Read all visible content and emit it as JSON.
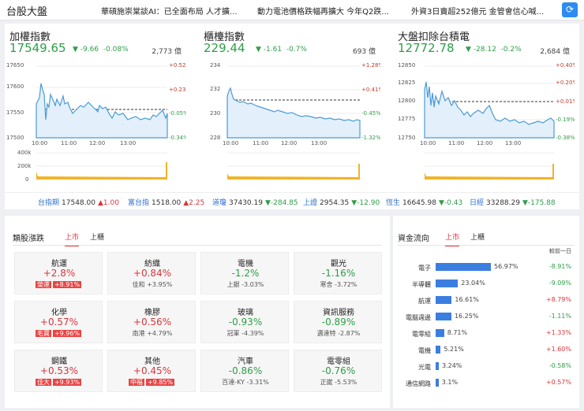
{
  "header": {
    "title": "台股大盤",
    "news": [
      "華碩施崇棠談AI：已全面布局 人才擴...",
      "動力電池價格跌幅再擴大 今年Q2跌...",
      "外資3日賣超252億元 金管會信心喊..."
    ],
    "refresh_icon": "refresh-icon"
  },
  "indices": [
    {
      "name": "加權指數",
      "value": "17549.65",
      "change": "-9.66",
      "pct": "-0.08%",
      "volume": "2,773 億",
      "y_left": [
        "17650",
        "17600",
        "17550",
        "17500"
      ],
      "y_right": [
        "+0.52%",
        "+0.23%",
        "-0.05%",
        "-0.34%"
      ],
      "x_ticks": [
        "10:00",
        "11:00",
        "12:00",
        "13:00"
      ],
      "vol_ticks": [
        "400k",
        "200k",
        "0"
      ]
    },
    {
      "name": "櫃檯指數",
      "value": "229.44",
      "change": "-1.61",
      "pct": "-0.7%",
      "volume": "693 億",
      "y_left": [
        "234",
        "232",
        "230",
        "228"
      ],
      "y_right": [
        "+1.28%",
        "+0.41%",
        "-0.45%",
        "-1.32%"
      ],
      "x_ticks": [
        "10:00",
        "11:00",
        "12:00",
        "13:00"
      ],
      "vol_ticks": [
        "400k",
        "200k",
        "0"
      ]
    },
    {
      "name": "大盤扣除台積電",
      "value": "12772.78",
      "change": "-28.12",
      "pct": "-0.2%",
      "volume": "2,684 億",
      "y_left": [
        "12850",
        "12825",
        "12800",
        "12775",
        "12750"
      ],
      "y_right": [
        "+0.40%",
        "+0.20%",
        "+0.01%",
        "-0.19%",
        "-0.38%"
      ],
      "x_ticks": [
        "10:00",
        "11:00",
        "12:00",
        "13:00"
      ],
      "vol_ticks": [
        "400k",
        "200k",
        "0"
      ]
    }
  ],
  "futures": [
    {
      "name": "台指期",
      "value": "17548.00",
      "change": "▲1.00",
      "dir": "up"
    },
    {
      "name": "富台指",
      "value": "1518.00",
      "change": "▲2.25",
      "dir": "up"
    },
    {
      "name": "道瓊",
      "value": "37430.19",
      "change": "▼-284.85",
      "dir": "dn"
    },
    {
      "name": "上證",
      "value": "2954.35",
      "change": "▼-12.90",
      "dir": "dn"
    },
    {
      "name": "恆生",
      "value": "16645.98",
      "change": "▼-0.43",
      "dir": "dn"
    },
    {
      "name": "日經",
      "value": "33288.29",
      "change": "▼-175.88",
      "dir": "dn"
    }
  ],
  "sectors": {
    "title": "類股漲跌",
    "tabs": [
      "上市",
      "上櫃"
    ],
    "cards": [
      {
        "name": "航運",
        "pct": "+2.8%",
        "dir": "up",
        "stock": "榮運",
        "stock_pct": "+8.91%",
        "badge": true
      },
      {
        "name": "紡織",
        "pct": "+0.84%",
        "dir": "up",
        "stock": "佳和",
        "stock_pct": "+3.95%",
        "badge": false
      },
      {
        "name": "電機",
        "pct": "-1.2%",
        "dir": "dn",
        "stock": "上銀",
        "stock_pct": "-3.03%",
        "badge": false
      },
      {
        "name": "觀光",
        "pct": "-1.16%",
        "dir": "dn",
        "stock": "寒舍",
        "stock_pct": "-3.72%",
        "badge": false
      },
      {
        "name": "化學",
        "pct": "+0.57%",
        "dir": "up",
        "stock": "毛寶",
        "stock_pct": "+9.96%",
        "badge": true
      },
      {
        "name": "橡膠",
        "pct": "+0.56%",
        "dir": "up",
        "stock": "南港",
        "stock_pct": "+4.79%",
        "badge": false
      },
      {
        "name": "玻璃",
        "pct": "-0.93%",
        "dir": "dn",
        "stock": "冠軍",
        "stock_pct": "-4.39%",
        "badge": false
      },
      {
        "name": "資訊服務",
        "pct": "-0.89%",
        "dir": "dn",
        "stock": "邁達特",
        "stock_pct": "-2.87%",
        "badge": false
      },
      {
        "name": "鋼鐵",
        "pct": "+0.53%",
        "dir": "up",
        "stock": "佳大",
        "stock_pct": "+9.93%",
        "badge": true
      },
      {
        "name": "其他",
        "pct": "+0.45%",
        "dir": "up",
        "stock": "中福",
        "stock_pct": "+9.85%",
        "badge": true
      },
      {
        "name": "汽車",
        "pct": "-0.86%",
        "dir": "dn",
        "stock": "百達-KY",
        "stock_pct": "-3.31%",
        "badge": false
      },
      {
        "name": "電零組",
        "pct": "-0.76%",
        "dir": "dn",
        "stock": "正崴",
        "stock_pct": "-5.53%",
        "badge": false
      }
    ]
  },
  "flow": {
    "title": "資金流向",
    "tabs": [
      "上市",
      "上櫃"
    ],
    "prev_label": "較前一日",
    "rows": [
      {
        "name": "電子",
        "share": 56.97,
        "share_label": "56.97%",
        "change": "-8.91%",
        "dir": "dn"
      },
      {
        "name": "半導體",
        "share": 23.04,
        "share_label": "23.04%",
        "change": "-9.09%",
        "dir": "dn"
      },
      {
        "name": "航運",
        "share": 16.61,
        "share_label": "16.61%",
        "change": "+8.79%",
        "dir": "up"
      },
      {
        "name": "電腦週邊",
        "share": 16.25,
        "share_label": "16.25%",
        "change": "-1.11%",
        "dir": "dn"
      },
      {
        "name": "電零組",
        "share": 8.71,
        "share_label": "8.71%",
        "change": "+1.33%",
        "dir": "up"
      },
      {
        "name": "電機",
        "share": 5.21,
        "share_label": "5.21%",
        "change": "+1.60%",
        "dir": "up"
      },
      {
        "name": "光電",
        "share": 3.24,
        "share_label": "3.24%",
        "change": "-0.58%",
        "dir": "dn"
      },
      {
        "name": "通信網路",
        "share": 3.1,
        "share_label": "3.1%",
        "change": "+0.57%",
        "dir": "up"
      }
    ]
  },
  "colors": {
    "up": "#d9363e",
    "down": "#2e9e48",
    "accent": "#2d8cf0",
    "bar": "#3a7ee0",
    "area": "#e3f0fb",
    "line": "#4b9bd8",
    "volume": "#f0b429"
  }
}
